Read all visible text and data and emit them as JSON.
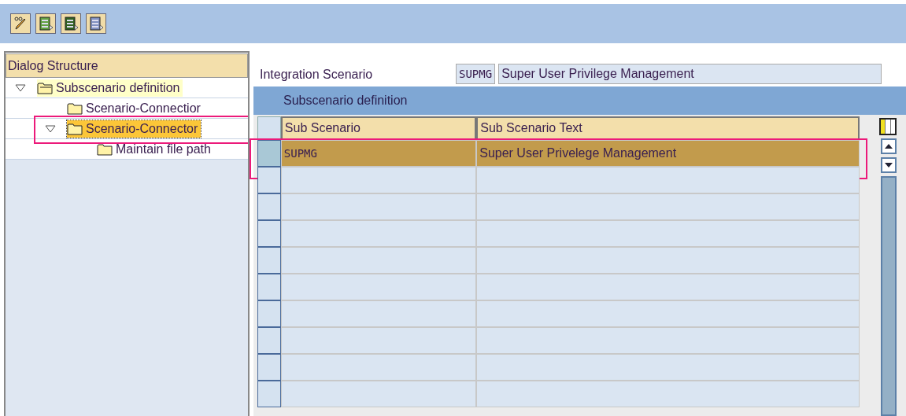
{
  "toolbar": {
    "buttons": [
      {
        "kind": "edit"
      },
      {
        "kind": "green"
      },
      {
        "kind": "darkgreen"
      },
      {
        "kind": "blue"
      }
    ]
  },
  "dialog_structure": {
    "title": "Dialog Structure",
    "tree": [
      {
        "label": "Subscenario definition",
        "expanded": true,
        "selected": false,
        "open_folder": true,
        "annotated": false,
        "children": [
          {
            "label": "Scenario-Connectior",
            "selected": false,
            "open_folder": false,
            "annotated": false
          },
          {
            "label": "Scenario-Connector",
            "expanded": true,
            "selected": true,
            "open_folder": false,
            "annotated": true,
            "children": [
              {
                "label": "Maintain file path",
                "selected": false,
                "open_folder": false,
                "annotated": false
              }
            ]
          }
        ]
      }
    ]
  },
  "integration_scenario": {
    "label": "Integration Scenario",
    "code": "SUPMG",
    "text": "Super User Privilege Management"
  },
  "table": {
    "title": "Subscenario definition",
    "columns": [
      "Sub Scenario",
      "Sub Scenario Text"
    ],
    "rows": [
      {
        "cells": [
          "SUPMG",
          "Super User Privelege Management"
        ],
        "selected": true,
        "annotated": true
      },
      {
        "cells": [],
        "selected": false,
        "annotated": false
      },
      {
        "cells": [],
        "selected": false,
        "annotated": false
      },
      {
        "cells": [],
        "selected": false,
        "annotated": false
      },
      {
        "cells": [],
        "selected": false,
        "annotated": false
      },
      {
        "cells": [],
        "selected": false,
        "annotated": false
      },
      {
        "cells": [],
        "selected": false,
        "annotated": false
      },
      {
        "cells": [],
        "selected": false,
        "annotated": false
      },
      {
        "cells": [],
        "selected": false,
        "annotated": false
      },
      {
        "cells": [],
        "selected": false,
        "annotated": false
      }
    ]
  }
}
